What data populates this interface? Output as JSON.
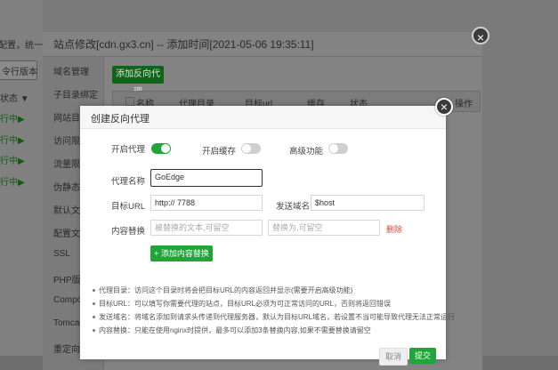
{
  "background": {
    "left_items": [
      "配置，统一类",
      "令行版本",
      "状态 ▼",
      "行中▶",
      "行中▶",
      "行中▶",
      "行中▶"
    ],
    "window_title": "站点修改[cdn.gx3.cn] -- 添加时间[2021-05-06 19:35:11]",
    "sidebar": [
      "域名管理",
      "子目录绑定",
      "网站目录",
      "访问限制",
      "流量限制",
      "伪静态",
      "默认文档",
      "配置文件",
      "SSL",
      "PHP版本",
      "Compose",
      "Tomcat",
      "重定向"
    ],
    "add_button": "添加反向代理",
    "table_headers": [
      "名称",
      "代理目录",
      "目标url",
      "缓存",
      "状态",
      "操作"
    ],
    "close_icon": "×"
  },
  "dialog": {
    "title": "创建反向代理",
    "close_icon": "×",
    "toggles": {
      "enable_proxy": {
        "label": "开启代理",
        "on": true
      },
      "enable_cache": {
        "label": "开启缓存",
        "on": false
      },
      "advanced": {
        "label": "高级功能",
        "on": false
      }
    },
    "proxy_name": {
      "label": "代理名称",
      "value": "GoEdge"
    },
    "target_url": {
      "label": "目标URL",
      "value": "http://          7788"
    },
    "send_domain": {
      "label": "发送域名",
      "value": "$host"
    },
    "content_replace": {
      "label": "内容替换",
      "placeholder_from": "被替换的文本,可留空",
      "placeholder_to": "替换为,可留空",
      "delete_label": "删除"
    },
    "add_replace_button": "+ 添加内容替换",
    "notes": [
      "代理目录：访问这个目录时将会把目标URL的内容返回并显示(需要开启高级功能)",
      "目标URL：可以填写你需要代理的站点，目标URL必须为可正常访问的URL，否则将返回错误",
      "发送域名：将域名添加到请求头传递到代理服务器，默认为目标URL域名，若设置不当可能导致代理无法正常运行",
      "内容替换：只能在使用nginx时提供，最多可以添加3条替换内容,如果不需要替换请留空"
    ],
    "cancel_button": "取消",
    "submit_button": "提交"
  },
  "colors": {
    "accent": "#20a53a",
    "danger": "#e2413b"
  }
}
